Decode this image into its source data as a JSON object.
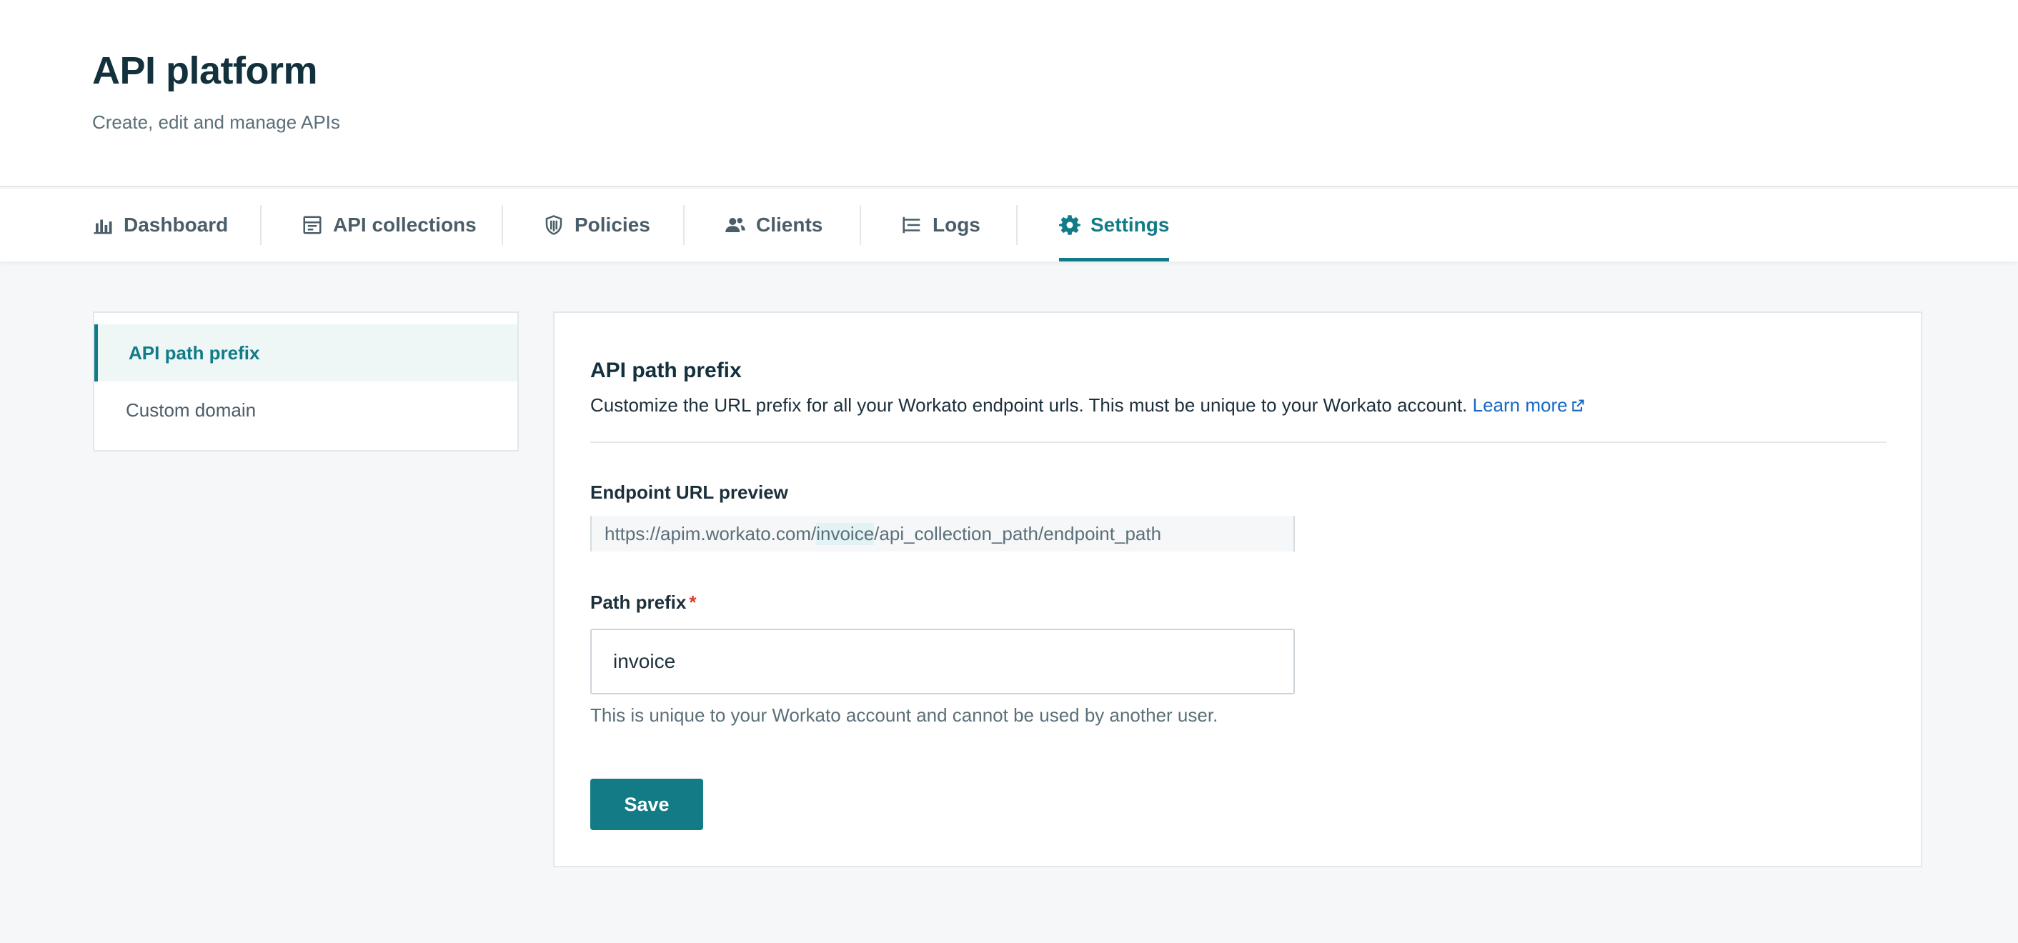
{
  "header": {
    "title": "API platform",
    "subtitle": "Create, edit and manage APIs"
  },
  "tabs": [
    {
      "label": "Dashboard",
      "icon": "bar-chart-icon"
    },
    {
      "label": "API collections",
      "icon": "collection-icon"
    },
    {
      "label": "Policies",
      "icon": "shield-icon"
    },
    {
      "label": "Clients",
      "icon": "users-icon"
    },
    {
      "label": "Logs",
      "icon": "logs-icon"
    },
    {
      "label": "Settings",
      "icon": "gear-icon",
      "active": true
    }
  ],
  "sidenav": {
    "items": [
      {
        "label": "API path prefix",
        "active": true
      },
      {
        "label": "Custom domain"
      }
    ]
  },
  "panel": {
    "title": "API path prefix",
    "description": "Customize the URL prefix for all your Workato endpoint urls. This must be unique to your Workato account.",
    "learn_more": "Learn more",
    "preview": {
      "label": "Endpoint URL preview",
      "url_before": "https://apim.workato.com/",
      "url_prefix": "invoice",
      "url_after": "/api_collection_path/endpoint_path"
    },
    "prefix": {
      "label": "Path prefix",
      "required_mark": "*",
      "value": "invoice",
      "hint": "This is unique to your Workato account and cannot be used by another user."
    },
    "save_label": "Save"
  },
  "colors": {
    "accent": "#117c87",
    "link": "#1668c4",
    "required": "#d93b2f",
    "button": "#137b86"
  }
}
